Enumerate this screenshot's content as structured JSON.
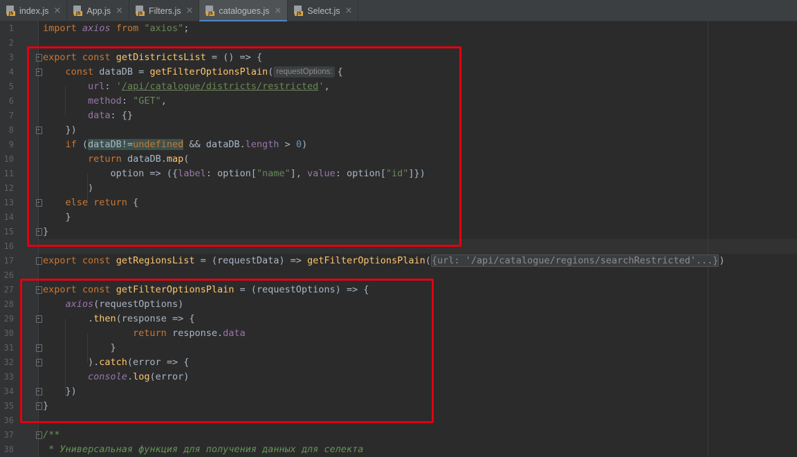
{
  "tabs": [
    {
      "name": "index.js",
      "active": false
    },
    {
      "name": "App.js",
      "active": false
    },
    {
      "name": "Filters.js",
      "active": false
    },
    {
      "name": "catalogues.js",
      "active": true
    },
    {
      "name": "Select.js",
      "active": false
    }
  ],
  "icons": {
    "file_icon": "js-file-icon",
    "badge_text": "JS",
    "close": "×"
  },
  "colors": {
    "highlight_box": "#e3000f",
    "keyword": "#cc7832",
    "function": "#ffc66d",
    "string": "#6a8759",
    "property": "#9876aa",
    "number": "#6897bb",
    "active_tab_underline": "#4a88c7"
  },
  "lines": [
    {
      "n": "1",
      "html": "<span class=\"kw\">import</span> <span class=\"prop it\">axios</span> <span class=\"kw\">from</span> <span class=\"str\">\"axios\"</span>;"
    },
    {
      "n": "2",
      "html": ""
    },
    {
      "n": "3",
      "html": "<span class=\"kw\">export const</span> <span class=\"fn\">getDistrictsList</span> = () => {"
    },
    {
      "n": "4",
      "html": "    <span class=\"kw\">const</span> dataDB = <span class=\"fn\">getFilterOptionsPlain</span>(<span class=\"hint\">requestOptions:</span>{"
    },
    {
      "n": "5",
      "html": "        <span class=\"prop\">url</span>: <span class=\"str\">'</span><span class=\"url\">/api/catalogue/districts/restricted</span><span class=\"str\">'</span>,"
    },
    {
      "n": "6",
      "html": "        <span class=\"prop\">method</span>: <span class=\"str\">\"GET\"</span>,"
    },
    {
      "n": "7",
      "html": "        <span class=\"prop\">data</span>: {}"
    },
    {
      "n": "8",
      "html": "    })"
    },
    {
      "n": "9",
      "html": "    <span class=\"kw\">if</span> (<span class=\"hl\">dataDB!=<span class=\"kw\">undefined</span></span> && dataDB.<span class=\"prop\">length</span> > <span class=\"num\">0</span>)"
    },
    {
      "n": "10",
      "html": "        <span class=\"kw\">return</span> dataDB.<span class=\"method\">map</span>("
    },
    {
      "n": "11",
      "html": "            option => ({<span class=\"prop\">label</span>: option[<span class=\"str\">\"name\"</span>], <span class=\"prop\">value</span>: option[<span class=\"str\">\"id\"</span>]})"
    },
    {
      "n": "12",
      "html": "        )"
    },
    {
      "n": "13",
      "html": "    <span class=\"kw\">else return</span> {"
    },
    {
      "n": "14",
      "html": "    }"
    },
    {
      "n": "15",
      "html": "}"
    },
    {
      "n": "16",
      "html": ""
    },
    {
      "n": "17",
      "html": "<span class=\"kw\">export const</span> <span class=\"fn\">getRegionsList</span> = (requestData) => <span class=\"fn\">getFilterOptionsPlain</span>(<span class=\"folded\">{url: '/api/catalogue/regions/searchRestricted'...}</span>)"
    },
    {
      "n": "26",
      "html": ""
    },
    {
      "n": "27",
      "html": "<span class=\"kw\">export const</span> <span class=\"fn\">getFilterOptionsPlain</span> = (requestOptions) => {"
    },
    {
      "n": "28",
      "html": "    <span class=\"prop it\">axios</span>(requestOptions)"
    },
    {
      "n": "29",
      "html": "        .<span class=\"method\">then</span>(response => {"
    },
    {
      "n": "30",
      "html": "                <span class=\"kw\">return</span> response.<span class=\"prop\">data</span>"
    },
    {
      "n": "31",
      "html": "            }"
    },
    {
      "n": "32",
      "html": "        ).<span class=\"method\">catch</span>(error => {"
    },
    {
      "n": "33",
      "html": "        <span class=\"glob\">console</span>.<span class=\"method\">log</span>(error)"
    },
    {
      "n": "34",
      "html": "    })"
    },
    {
      "n": "35",
      "html": "}"
    },
    {
      "n": "36",
      "html": ""
    },
    {
      "n": "37",
      "html": "<span class=\"cm\">/**</span>"
    },
    {
      "n": "38",
      "html": "<span class=\"cm\"> * Универсальная функция для получения данных для селекта</span>"
    }
  ]
}
